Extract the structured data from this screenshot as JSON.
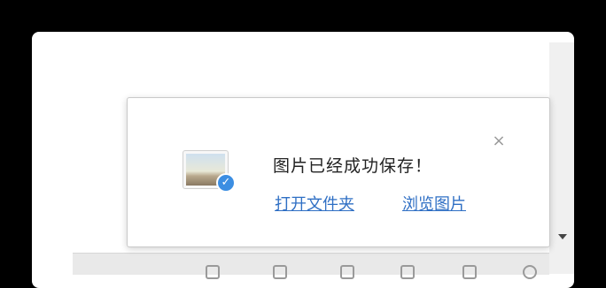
{
  "popup": {
    "message": "图片已经成功保存！",
    "open_folder_link": "打开文件夹",
    "view_image_link": "浏览图片",
    "close_glyph": "×"
  },
  "icons": {
    "saved_image": "image-thumbnail-icon",
    "check": "check-badge-icon"
  },
  "colors": {
    "link": "#2f6fc4",
    "badge": "#3c8ee2",
    "backdrop": "#000000"
  }
}
